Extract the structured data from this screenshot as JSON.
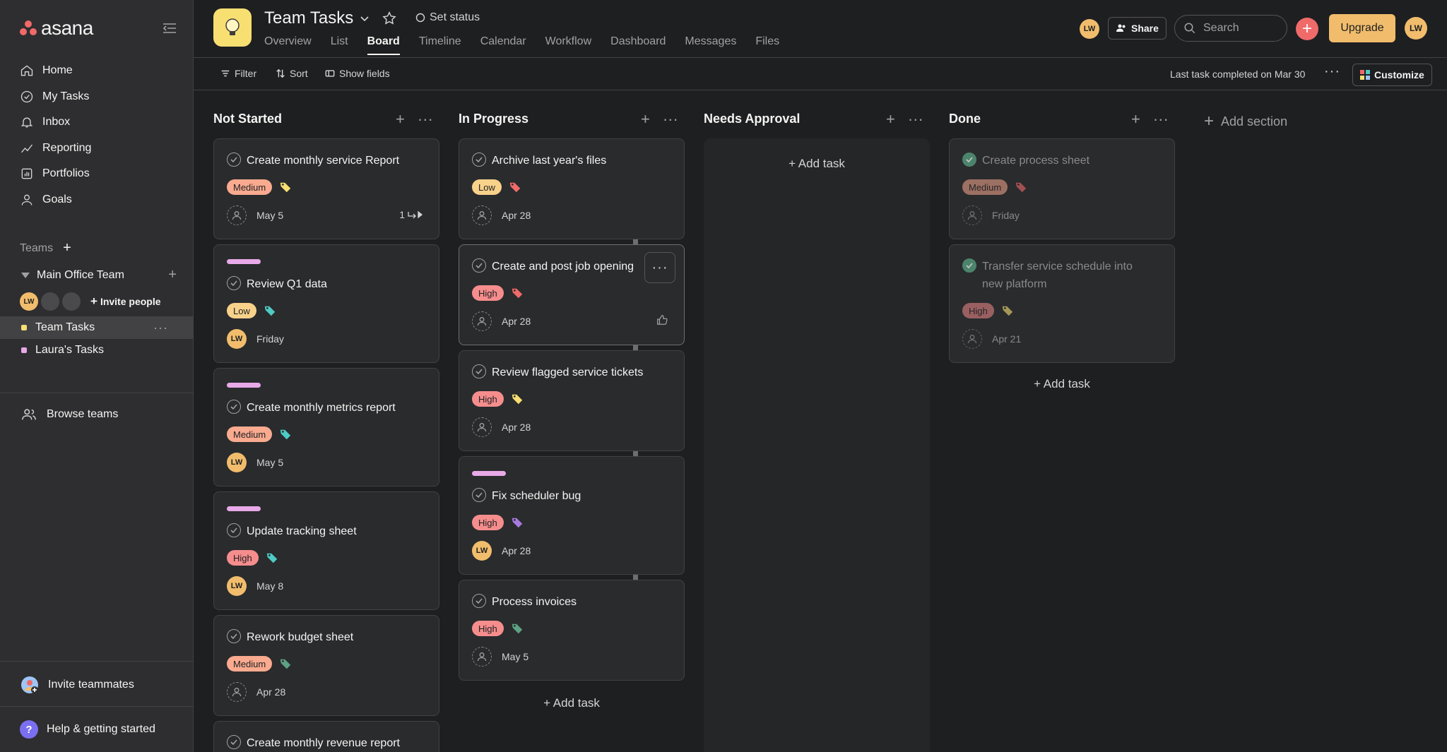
{
  "app": {
    "logo_text": "asana"
  },
  "sidebar": {
    "nav": [
      {
        "label": "Home",
        "icon": "home-icon"
      },
      {
        "label": "My Tasks",
        "icon": "check-circle-icon"
      },
      {
        "label": "Inbox",
        "icon": "bell-icon"
      },
      {
        "label": "Reporting",
        "icon": "chart-line-icon"
      },
      {
        "label": "Portfolios",
        "icon": "portfolio-icon"
      },
      {
        "label": "Goals",
        "icon": "person-icon"
      }
    ],
    "teams_label": "Teams",
    "team_name": "Main Office Team",
    "invite_people": "Invite people",
    "member_initials": "LW",
    "projects": [
      {
        "label": "Team Tasks",
        "color": "#f8df72",
        "active": true
      },
      {
        "label": "Laura's Tasks",
        "color": "#e8a9e8",
        "active": false
      }
    ],
    "browse_teams": "Browse teams",
    "invite_teammates": "Invite teammates",
    "help": "Help & getting started"
  },
  "header": {
    "project_title": "Team Tasks",
    "set_status": "Set status",
    "tabs": [
      "Overview",
      "List",
      "Board",
      "Timeline",
      "Calendar",
      "Workflow",
      "Dashboard",
      "Messages",
      "Files"
    ],
    "active_tab": "Board",
    "avatar_initials": "LW",
    "share": "Share",
    "search_placeholder": "Search",
    "upgrade": "Upgrade",
    "user_initials": "LW"
  },
  "toolbar": {
    "filter": "Filter",
    "sort": "Sort",
    "show_fields": "Show fields",
    "last_completed": "Last task completed on Mar 30",
    "customize": "Customize"
  },
  "board": {
    "add_task": "Add task",
    "add_section": "Add section",
    "columns": [
      {
        "name": "Not Started",
        "cards": [
          {
            "title": "Create monthly service Report",
            "priority": "Medium",
            "tag_color": "#f8df72",
            "assignee": "",
            "date": "May 5",
            "subtasks": "1",
            "stripe": false
          },
          {
            "title": "Review Q1 data",
            "priority": "Low",
            "tag_color": "#4ecbc4",
            "assignee": "LW",
            "date": "Friday",
            "stripe": true
          },
          {
            "title": "Create monthly metrics report",
            "priority": "Medium",
            "tag_color": "#4ecbc4",
            "assignee": "LW",
            "date": "May 5",
            "stripe": true
          },
          {
            "title": "Update tracking sheet",
            "priority": "High",
            "tag_color": "#4ecbc4",
            "assignee": "LW",
            "date": "May 8",
            "stripe": true
          },
          {
            "title": "Rework budget sheet",
            "priority": "Medium",
            "tag_color": "#5da283",
            "assignee": "",
            "date": "Apr 28",
            "stripe": false
          },
          {
            "title": "Create monthly revenue report",
            "priority": "",
            "stripe": false
          }
        ]
      },
      {
        "name": "In Progress",
        "cards": [
          {
            "title": "Archive last year's files",
            "priority": "Low",
            "tag_color": "#f06a6a",
            "assignee": "",
            "date": "Apr 28",
            "stripe": false
          },
          {
            "title": "Create and post job opening",
            "priority": "High",
            "tag_color": "#f06a6a",
            "assignee": "",
            "date": "Apr 28",
            "stripe": false,
            "hover": true
          },
          {
            "title": "Review flagged service tickets",
            "priority": "High",
            "tag_color": "#f8df72",
            "assignee": "",
            "date": "Apr 28",
            "stripe": false
          },
          {
            "title": "Fix scheduler bug",
            "priority": "High",
            "tag_color": "#a77be0",
            "assignee": "LW",
            "date": "Apr 28",
            "stripe": true
          },
          {
            "title": "Process invoices",
            "priority": "High",
            "tag_color": "#5da283",
            "assignee": "",
            "date": "May 5",
            "stripe": false
          }
        ]
      },
      {
        "name": "Needs Approval",
        "cards": []
      },
      {
        "name": "Done",
        "cards": [
          {
            "title": "Create process sheet",
            "priority": "Medium",
            "tag_color": "#f06a6a",
            "assignee": "",
            "date": "Friday",
            "stripe": false,
            "done": true
          },
          {
            "title": "Transfer service schedule into new platform",
            "priority": "High",
            "tag_color": "#f8df72",
            "assignee": "",
            "date": "Apr 21",
            "stripe": false,
            "done": true
          }
        ]
      }
    ]
  }
}
